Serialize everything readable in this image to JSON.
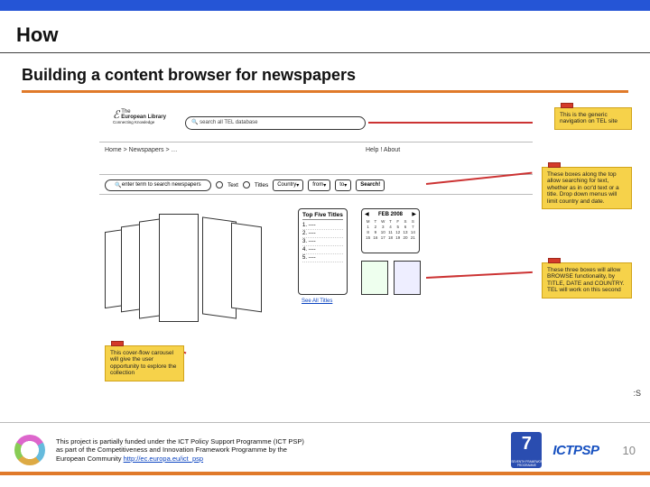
{
  "header": {
    "title": "How"
  },
  "subtitle": "Building a content browser for newspapers",
  "logo": {
    "prefix": "The",
    "name": "European Library",
    "tagline": "Connecting Knowledge"
  },
  "topsearch": {
    "placeholder": "search all TEL database"
  },
  "breadcrumb": "Home > Newspapers > …",
  "helpabout": "Help !    About",
  "searchrow": {
    "input": "enter term to search newspapers",
    "radio1": "Text",
    "radio2": "Titles",
    "country": "Country",
    "from": "from",
    "to": "to",
    "go": "Search!"
  },
  "topfive": {
    "heading": "Top Five Titles",
    "items": [
      "1. ----",
      "2. ----",
      "3. ----",
      "4. ----",
      "5. ----"
    ],
    "seeall": "See All Titles"
  },
  "calendar": {
    "label": "FEB 2008"
  },
  "notes": {
    "nav": "This is the generic navigation on TEL site",
    "search": "These boxes along the top allow searching for text, whether as in ocr'd text or a title. Drop down menus will limit country and date.",
    "browse": "These three boxes will allow BROWSE functionality, by TITLE, DATE and COUNTRY. TEL will work on this second",
    "carousel": "This cover-flow carousel will give the user opportunity to explore the collection"
  },
  "cropped": ":S",
  "footer": {
    "text1": "This project is partially funded under the ICT Policy Support Programme (ICT PSP)",
    "text2": "as part of the Competitiveness and Innovation Framework Programme by the",
    "text3": "European Community",
    "link": "http://ec.europa.eu/ict_psp",
    "program": "ICTPSP",
    "page": "10"
  }
}
